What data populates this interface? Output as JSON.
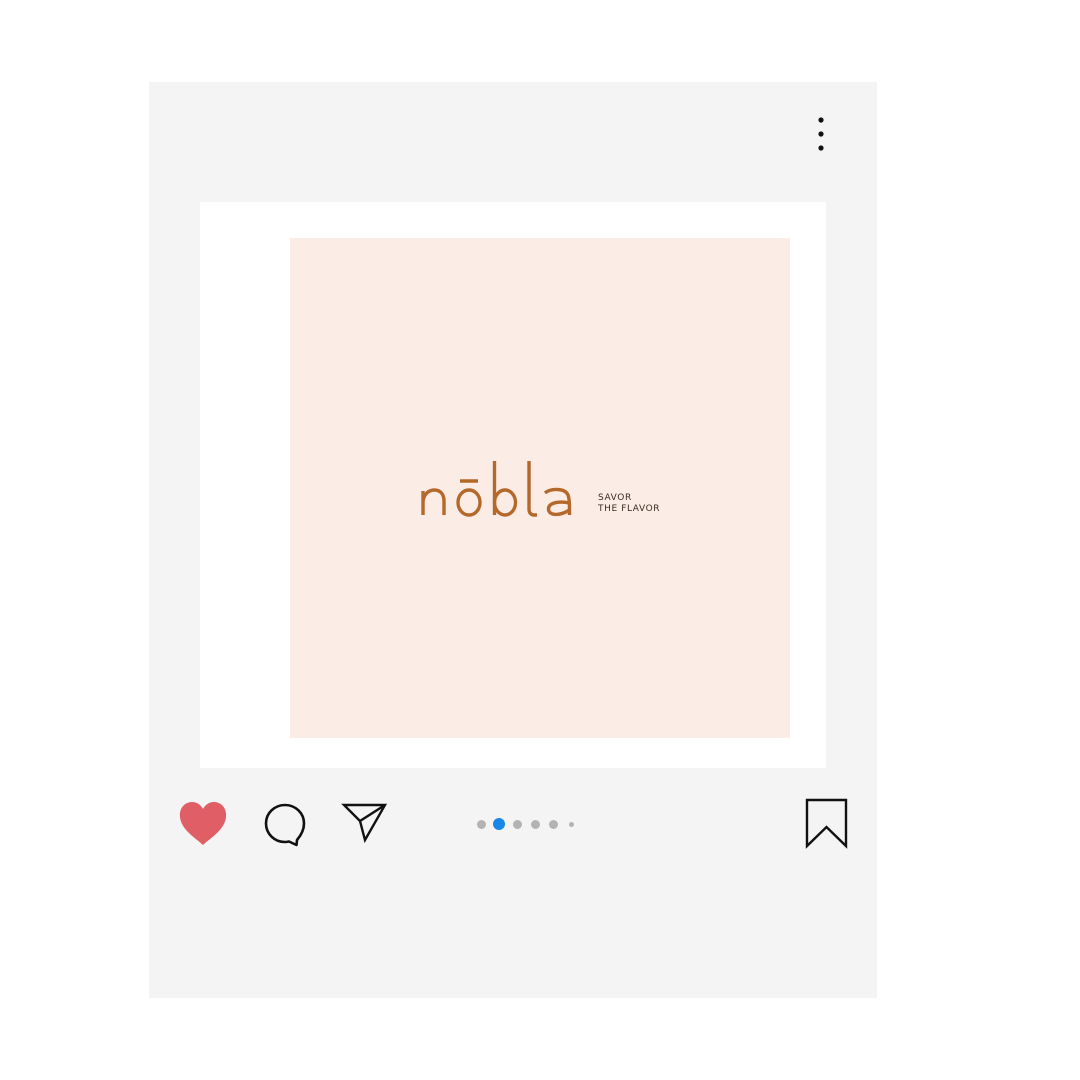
{
  "post": {
    "menu_icon": "more-vertical-icon",
    "image": {
      "background_color": "#fbece5",
      "brand": {
        "name": "nōbla",
        "tagline_line1": "SAVOR",
        "tagline_line2": "THE FLAVOR",
        "color": "#b4682a"
      }
    },
    "actions": {
      "like": {
        "icon": "heart-icon",
        "liked": true,
        "color": "#e05e66"
      },
      "comment": {
        "icon": "comment-bubble-icon"
      },
      "share": {
        "icon": "paper-plane-icon"
      },
      "save": {
        "icon": "bookmark-icon"
      }
    },
    "carousel": {
      "total": 6,
      "current": 2,
      "active_color": "#1a86e8",
      "inactive_color": "#b3b3b3"
    }
  }
}
